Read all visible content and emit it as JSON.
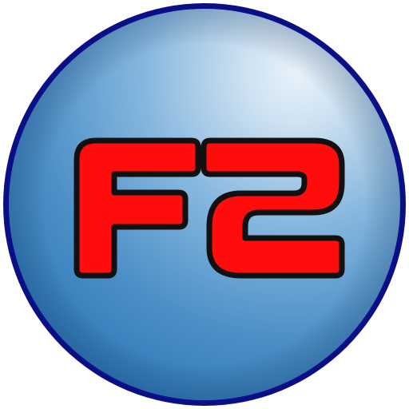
{
  "icon": {
    "logo_text": "F2",
    "colors": {
      "border": "#0b0f86",
      "sphere_light": "#e8f3fb",
      "sphere_mid": "#86b7de",
      "sphere_dark": "#2c77b6",
      "letter_fill": "#ff0d0d",
      "letter_outline": "#111111"
    }
  }
}
